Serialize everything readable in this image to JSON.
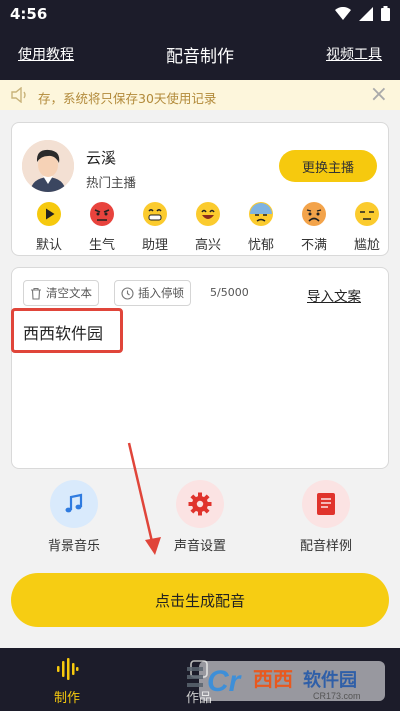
{
  "status_bar": {
    "time": "4:56"
  },
  "nav": {
    "left_link": "使用教程",
    "title": "配音制作",
    "right_link": "视频工具"
  },
  "notice": {
    "text": "存，系统将只保存30天使用记录",
    "left_icon": "speaker-icon",
    "close_icon": "close-icon"
  },
  "anchor": {
    "name": "云溪",
    "tag": "热门主播",
    "change_button": "更换主播"
  },
  "emotions": [
    {
      "label": "默认",
      "icon": "play-icon"
    },
    {
      "label": "生气",
      "icon": "angry-face-icon"
    },
    {
      "label": "助理",
      "icon": "grin-face-icon"
    },
    {
      "label": "高兴",
      "icon": "happy-face-icon"
    },
    {
      "label": "忧郁",
      "icon": "sweat-face-icon"
    },
    {
      "label": "不满",
      "icon": "frown-face-icon"
    },
    {
      "label": "尴尬",
      "icon": "unamused-face-icon"
    }
  ],
  "editor": {
    "clear_button": "清空文本",
    "insert_pause_button": "插入停顿",
    "char_count": "5/5000",
    "import_link": "导入文案",
    "content": "西西软件园"
  },
  "features": [
    {
      "label": "背景音乐",
      "icon": "music-note-icon",
      "color": "#d9eafc"
    },
    {
      "label": "声音设置",
      "icon": "gear-icon",
      "color": "#fbe3e3"
    },
    {
      "label": "配音样例",
      "icon": "book-icon",
      "color": "#fbe3e3"
    }
  ],
  "generate_button": "点击生成配音",
  "tabs": [
    {
      "label": "制作",
      "icon": "waveform-icon",
      "active": true
    },
    {
      "label": "作品",
      "icon": "works-icon",
      "active": false
    }
  ],
  "watermark": {
    "brand": "西西软件园",
    "domain": "CR173.com"
  },
  "colors": {
    "accent": "#f6c90e",
    "nav_bg": "#1c1c2a",
    "highlight": "#e0453a",
    "notice_bg": "#fdf6dc"
  }
}
